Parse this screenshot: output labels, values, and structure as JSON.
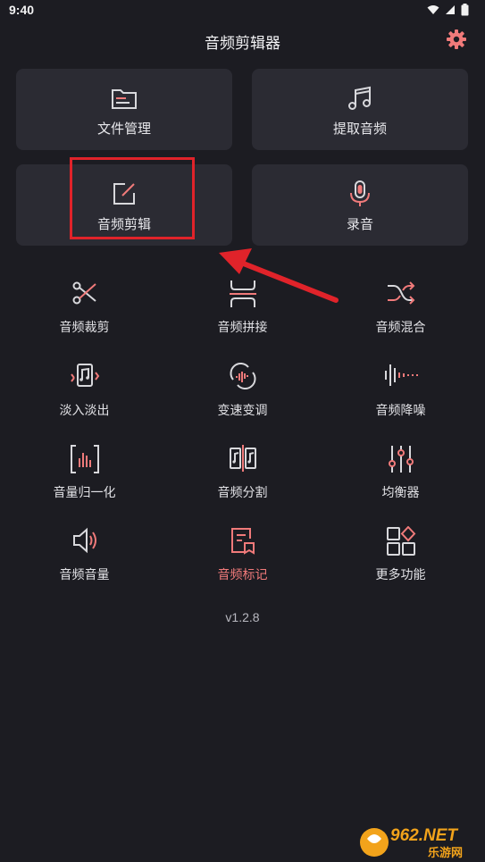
{
  "status": {
    "time": "9:40"
  },
  "header": {
    "title": "音频剪辑器"
  },
  "cards": [
    {
      "label": "文件管理",
      "icon": "folder-icon"
    },
    {
      "label": "提取音频",
      "icon": "music-note-icon"
    },
    {
      "label": "音频剪辑",
      "icon": "edit-icon"
    },
    {
      "label": "录音",
      "icon": "microphone-icon"
    }
  ],
  "tools": [
    {
      "label": "音频裁剪",
      "icon": "scissors-icon"
    },
    {
      "label": "音频拼接",
      "icon": "merge-icon"
    },
    {
      "label": "音频混合",
      "icon": "shuffle-icon"
    },
    {
      "label": "淡入淡出",
      "icon": "fade-icon"
    },
    {
      "label": "变速变调",
      "icon": "speed-icon"
    },
    {
      "label": "音频降噪",
      "icon": "noise-reduce-icon"
    },
    {
      "label": "音量归一化",
      "icon": "normalize-icon"
    },
    {
      "label": "音频分割",
      "icon": "split-icon"
    },
    {
      "label": "均衡器",
      "icon": "equalizer-icon"
    },
    {
      "label": "音频音量",
      "icon": "volume-icon"
    },
    {
      "label": "音频标记",
      "icon": "marker-icon",
      "active": true
    },
    {
      "label": "更多功能",
      "icon": "more-icon"
    }
  ],
  "footer": {
    "version": "v1.2.8"
  },
  "watermark": {
    "text": "962.NET",
    "sub": "乐游网"
  },
  "colors": {
    "background": "#1c1c22",
    "card": "#2b2b33",
    "accent": "#f07a7a",
    "annotation": "#e0232a"
  }
}
